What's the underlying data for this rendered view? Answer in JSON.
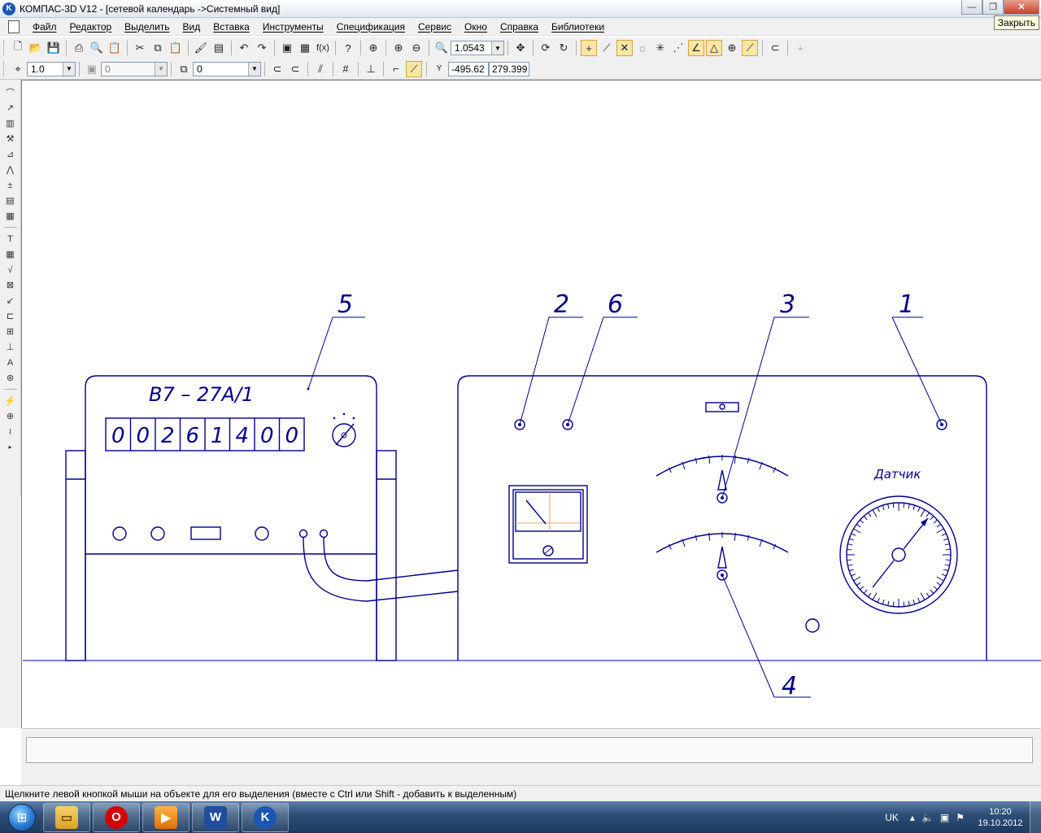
{
  "window": {
    "title": "КОМПАС-3D V12 - [сетевой календарь ->Системный вид]",
    "close_tooltip": "Закрыть",
    "minimize_glyph": "—",
    "maximize_glyph": "❐",
    "close_glyph": "✕"
  },
  "menu": [
    "Файл",
    "Редактор",
    "Выделить",
    "Вид",
    "Вставка",
    "Инструменты",
    "Спецификация",
    "Сервис",
    "Окно",
    "Справка",
    "Библиотеки"
  ],
  "toolbar": {
    "zoom_value": "1.0543",
    "fx_label": "f(x)"
  },
  "toolbar2": {
    "step_value": "1.0",
    "style_value": "0",
    "layer_value": "0",
    "cursor_x": "-495.62",
    "cursor_y": "279.399"
  },
  "drawing": {
    "device_label": "В7 – 27А/1",
    "digits": [
      "0",
      "0",
      "2",
      "6",
      "1",
      "4",
      "0",
      "0"
    ],
    "sensor_label": "Датчик",
    "callouts": [
      "5",
      "2",
      "6",
      "3",
      "1",
      "4"
    ]
  },
  "status": {
    "hint": "Щелкните левой кнопкой мыши на объекте для его выделения (вместе с Ctrl или Shift - добавить к выделенным)"
  },
  "taskbar": {
    "apps": [
      "explorer-icon",
      "opera-icon",
      "media-player-icon",
      "word-icon",
      "kompas-icon"
    ],
    "lang": "UK",
    "time": "10:20",
    "date": "19.10.2012"
  },
  "colors": {
    "drawing_line": "#00008b",
    "background": "#ffffff"
  }
}
